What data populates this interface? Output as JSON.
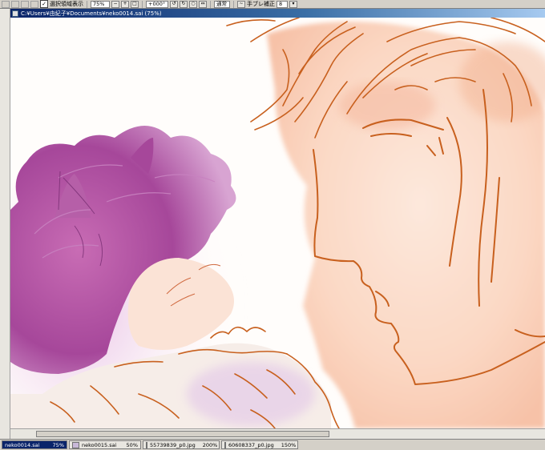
{
  "toolbar": {
    "show_selection_label": "選択領域表示",
    "show_selection_checked": "✓",
    "zoom_value": "75%",
    "rotation_value": "+000°",
    "blend_mode": "通常",
    "stabilizer_label": "手ブレ補正",
    "stabilizer_value": "8"
  },
  "document": {
    "title": "C:¥Users¥由紀子¥Documents¥neko0014.sai (75%)"
  },
  "tabs": [
    {
      "name": "neko0014.sai",
      "zoom": "75%"
    },
    {
      "name": "neko0015.sai",
      "zoom": "50%"
    },
    {
      "name": "55739839_p0.jpg",
      "zoom": "200%"
    },
    {
      "name": "60608337_p0.jpg",
      "zoom": "150%"
    }
  ],
  "colors": {
    "lineart": "#c8601e",
    "hair_purple": "#b0509e",
    "skin_peach": "#fbd5c0",
    "active_tab": "#0a246a"
  }
}
